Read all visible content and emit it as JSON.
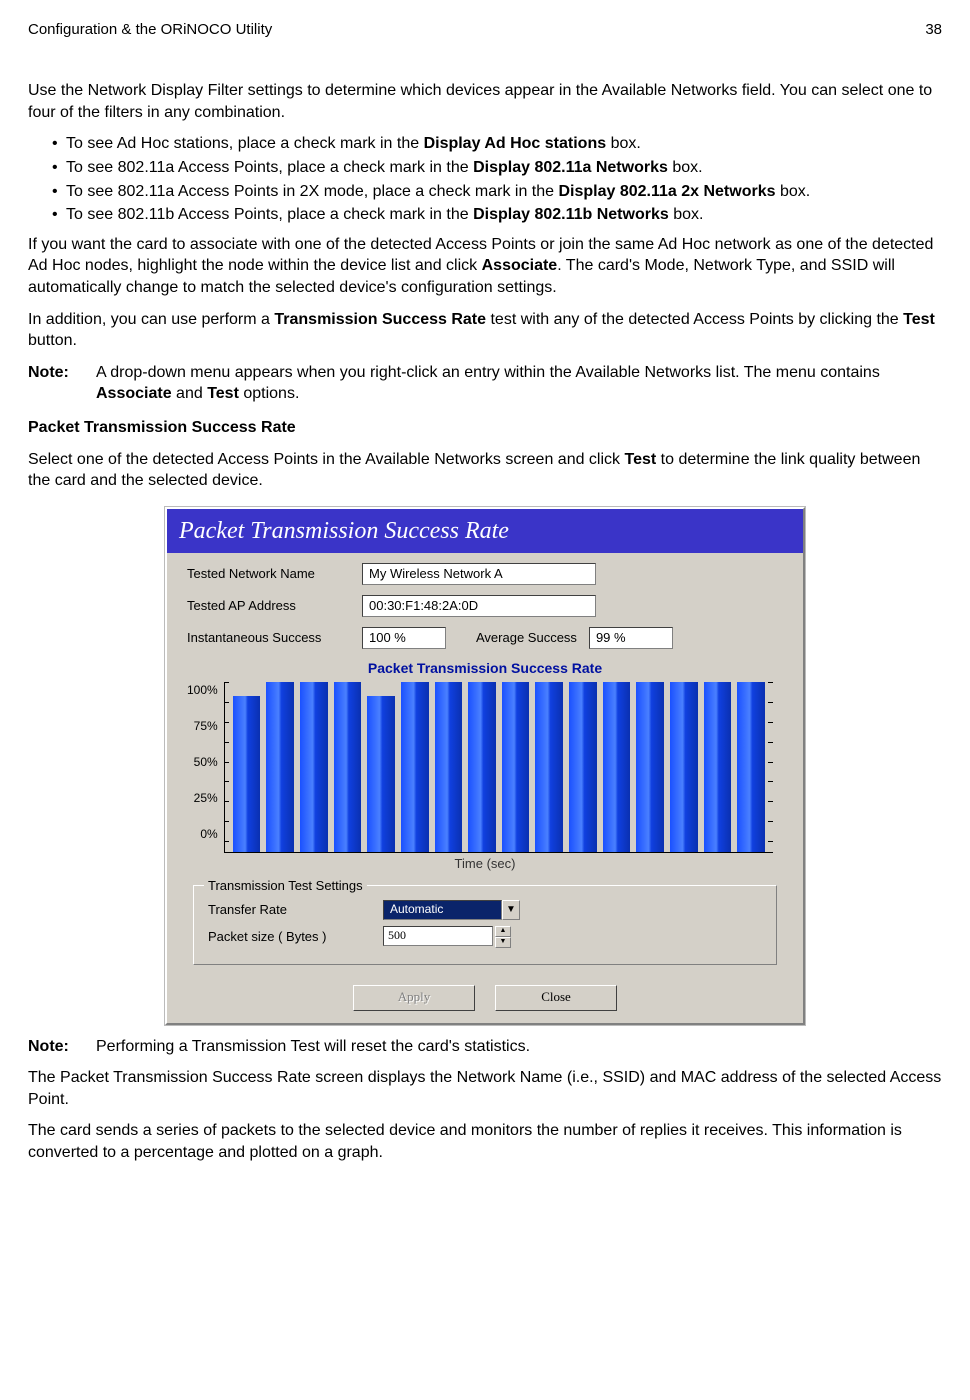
{
  "header": {
    "left": "Configuration & the ORiNOCO Utility",
    "right": "38"
  },
  "intro": "Use the Network Display Filter settings to determine which devices appear in the Available Networks field. You can select one to four of the filters in any combination.",
  "bullets": [
    {
      "pre": "To see Ad Hoc stations, place a check mark in the ",
      "bold": "Display Ad Hoc stations",
      "post": " box."
    },
    {
      "pre": "To see 802.11a Access Points, place a check mark in the ",
      "bold": "Display 802.11a Networks",
      "post": " box."
    },
    {
      "pre": "To see 802.11a Access Points in 2X mode, place a check mark in the ",
      "bold": "Display 802.11a 2x Networks",
      "post": " box."
    },
    {
      "pre": "To see 802.11b Access Points, place a check mark in the ",
      "bold": "Display 802.11b Networks",
      "post": " box."
    }
  ],
  "para_assoc": {
    "a": "If you want the card to associate with one of the detected Access Points or join the same Ad Hoc network as one of the detected Ad Hoc nodes, highlight the node within the device list and click ",
    "b": "Associate",
    "c": ". The card's Mode, Network Type, and SSID will automatically change to match the selected device's configuration settings."
  },
  "para_test": {
    "a": "In addition, you can use perform a ",
    "b": "Transmission Success Rate",
    "c": " test with any of the detected Access Points by clicking the ",
    "d": "Test",
    "e": " button."
  },
  "note1": {
    "label": "Note:",
    "a": "A drop-down menu appears when you right-click an entry within the Available Networks list. The menu contains ",
    "b": "Associate",
    "c": " and ",
    "d": "Test",
    "e": " options."
  },
  "section_h": "Packet Transmission Success Rate",
  "section_p": {
    "a": "Select one of the detected Access Points in the Available Networks screen and click ",
    "b": "Test",
    "c": " to determine the link quality between the card and the selected device."
  },
  "dialog": {
    "title": "Packet Transmission Success Rate",
    "fields": {
      "net_label": "Tested Network Name",
      "net_value": "My Wireless Network A",
      "ap_label": "Tested AP Address",
      "ap_value": "00:30:F1:48:2A:0D",
      "inst_label": "Instantaneous Success",
      "inst_value": "100 %",
      "avg_label": "Average Success",
      "avg_value": "99 %"
    },
    "chart_title": "Packet Transmission Success Rate",
    "yticks": [
      "100%",
      "75%",
      "50%",
      "25%",
      "0%"
    ],
    "xlabel": "Time (sec)",
    "groupbox": "Transmission Test Settings",
    "rate_label": "Transfer Rate",
    "rate_value": "Automatic",
    "size_label": "Packet size  ( Bytes )",
    "size_value": "500",
    "apply": "Apply",
    "close": "Close"
  },
  "note2": {
    "label": "Note:",
    "text": "Performing a Transmission Test will reset the card's statistics."
  },
  "tail1": "The Packet Transmission Success Rate screen displays the Network Name (i.e., SSID) and MAC address of the selected Access Point.",
  "tail2": "The card sends a series of packets to the selected device and monitors the number of replies it receives. This information is converted to a percentage and plotted on a graph.",
  "chart_data": {
    "type": "bar",
    "title": "Packet Transmission Success Rate",
    "xlabel": "Time (sec)",
    "ylabel": "",
    "ylim": [
      0,
      100
    ],
    "yticks": [
      0,
      25,
      50,
      75,
      100
    ],
    "values": [
      92,
      100,
      100,
      100,
      92,
      100,
      100,
      100,
      100,
      100,
      100,
      100,
      100,
      100,
      100,
      100
    ]
  }
}
